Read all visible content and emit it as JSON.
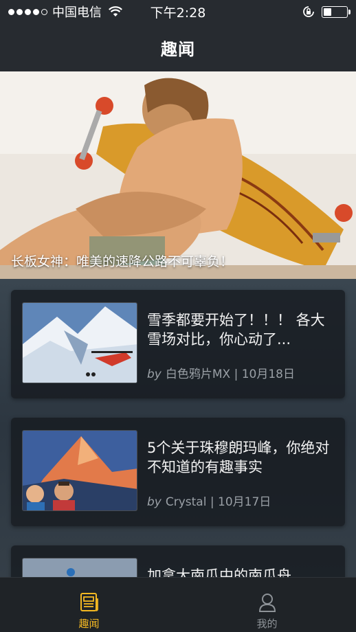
{
  "status": {
    "carrier": "中国电信",
    "time": "下午2:28"
  },
  "nav": {
    "title": "趣闻"
  },
  "banner": {
    "caption": "长板女神：唯美的速降公路不可辜负！",
    "pages": 2,
    "active_page": 1
  },
  "articles": [
    {
      "title": "雪季都要开始了！！！ 各大雪场对比，你心动了...",
      "by": "by",
      "author": "白色鸦片MX",
      "sep": "|",
      "date": "10月18日"
    },
    {
      "title": "5个关于珠穆朗玛峰，你绝对不知道的有趣事实",
      "by": "by",
      "author": "Crystal",
      "sep": "|",
      "date": "10月17日"
    },
    {
      "title": "加拿大南瓜中的南瓜舟",
      "by": "",
      "author": "",
      "sep": "",
      "date": ""
    }
  ],
  "tabbar": {
    "tabs": [
      {
        "label": "趣闻",
        "icon": "newspaper-icon"
      },
      {
        "label": "我的",
        "icon": "user-icon"
      }
    ],
    "active_color": "#f5b922"
  }
}
